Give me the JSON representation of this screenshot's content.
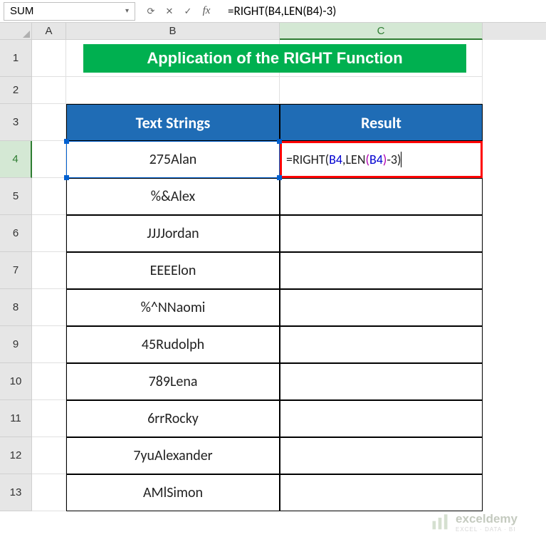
{
  "namebox": {
    "value": "SUM"
  },
  "formula_bar": {
    "formula_display": "=RIGHT(B4,LEN(B4)-3)",
    "formula_parts": {
      "p1": "=RIGHT(",
      "p2": "B4",
      "p3": ",LEN",
      "p4": "(",
      "p5": "B4",
      "p6": ")",
      "p7": "-3)"
    }
  },
  "columns": {
    "a": "A",
    "b": "B",
    "c": "C"
  },
  "rows": {
    "r1": "1",
    "r2": "2",
    "r3": "3",
    "r4": "4",
    "r5": "5",
    "r6": "6",
    "r7": "7",
    "r8": "8",
    "r9": "9",
    "r10": "10",
    "r11": "11",
    "r12": "12",
    "r13": "13"
  },
  "title": "Application of the RIGHT Function",
  "headers": {
    "b": "Text Strings",
    "c": "Result"
  },
  "data": {
    "b4": "275Alan",
    "b5": "%&Alex",
    "b6": "JJJJordan",
    "b7": "EEEElon",
    "b8": "%^NNaomi",
    "b9": "45Rudolph",
    "b10": "789Lena",
    "b11": "6rrRocky",
    "b12": "7yuAlexander",
    "b13": "AMlSimon"
  },
  "watermark": {
    "brand": "exceldemy",
    "sub": "EXCEL · DATA · BI"
  },
  "icons": {
    "cancel": "✕",
    "enter": "✓",
    "dropdown": "▾",
    "history": "⟳"
  }
}
